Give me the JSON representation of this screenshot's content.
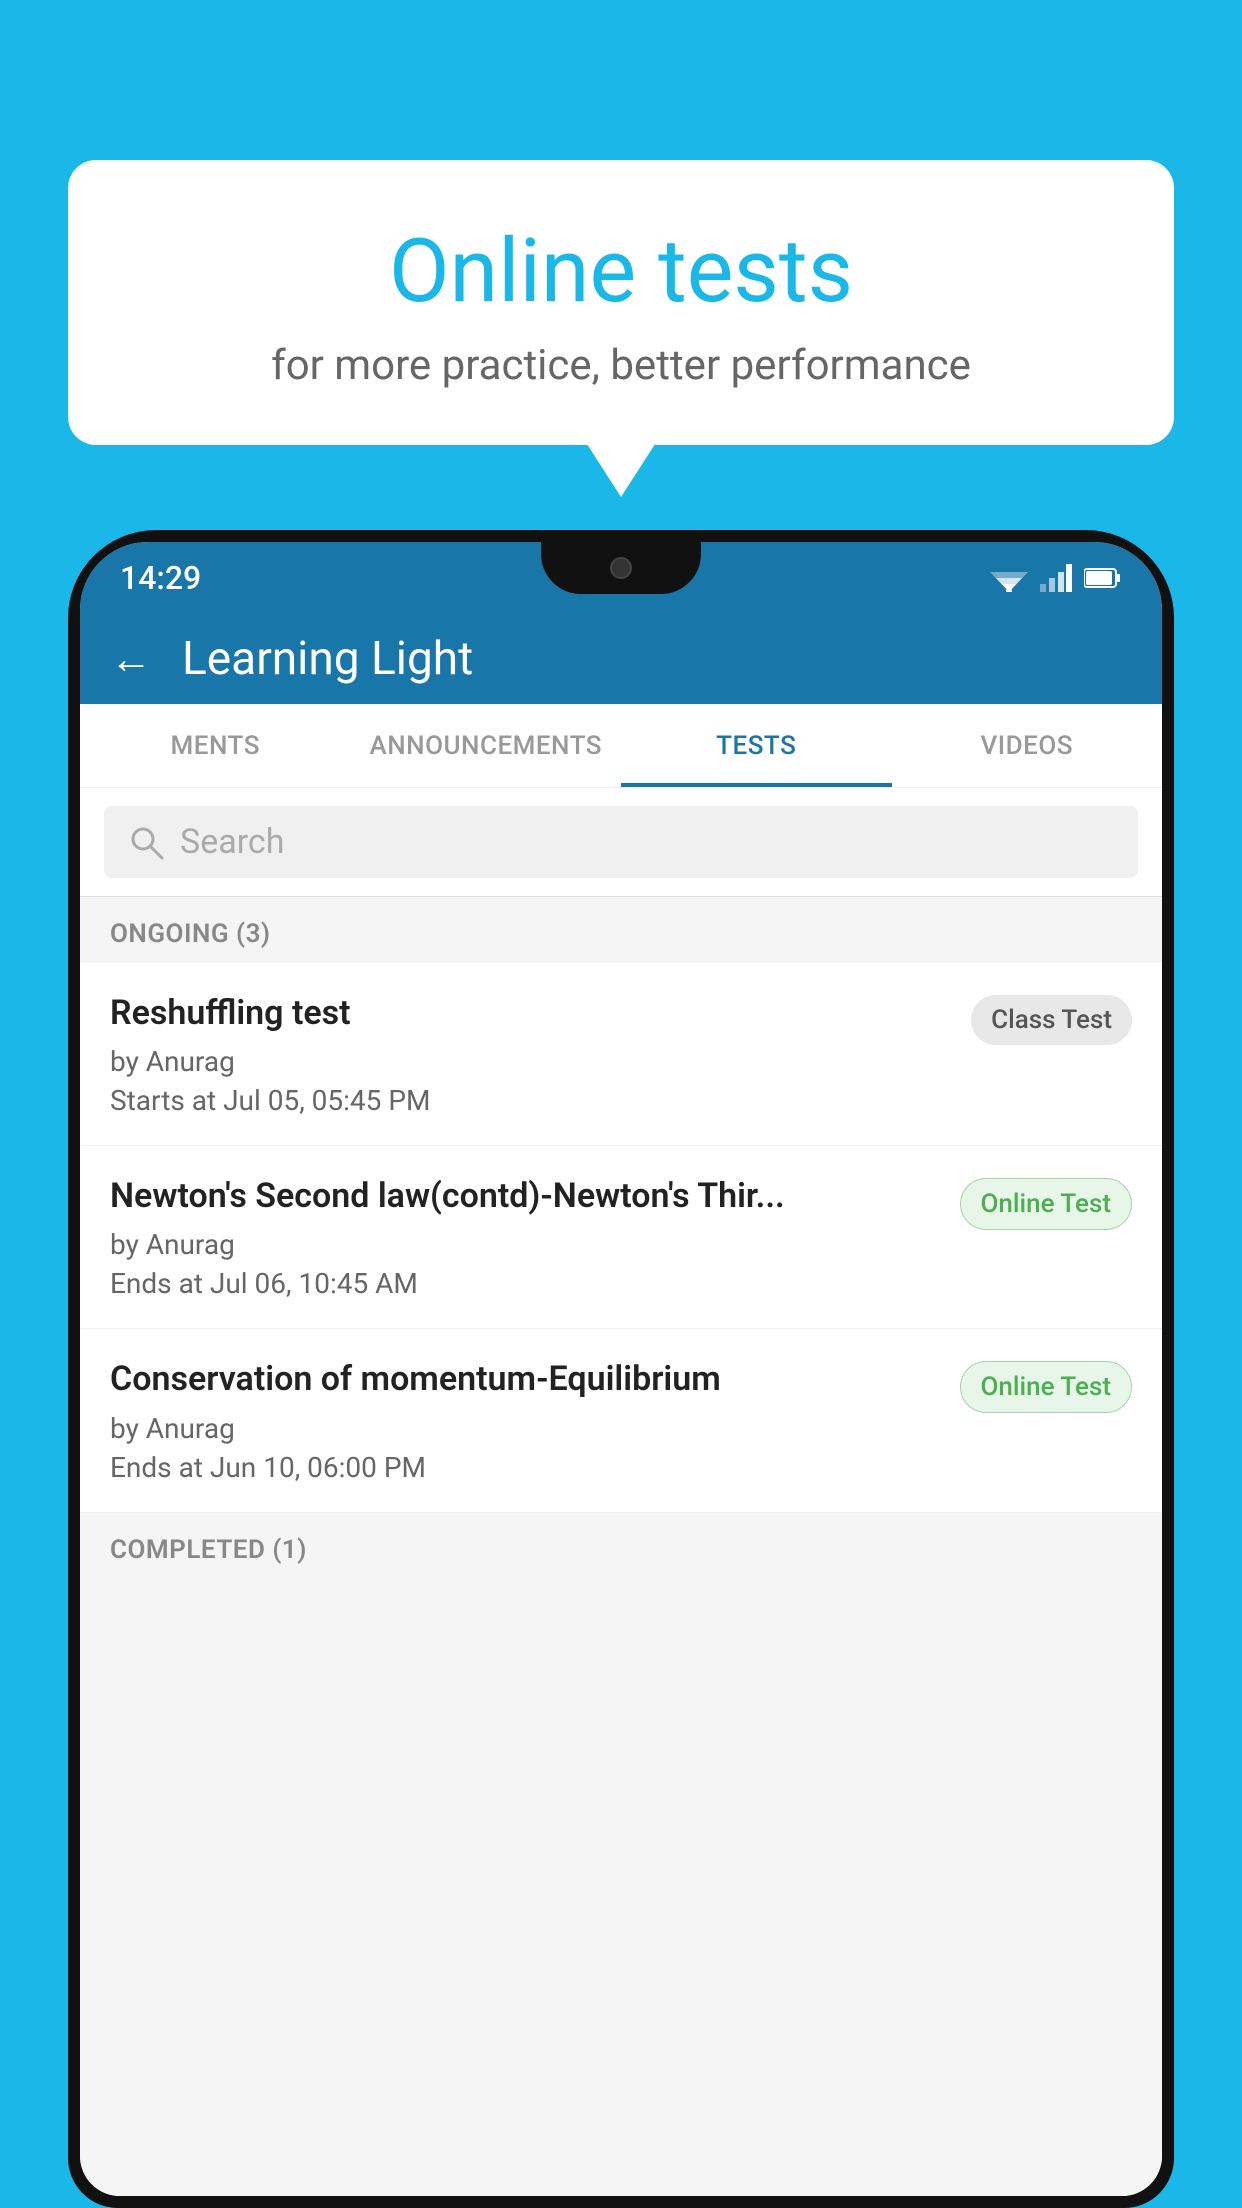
{
  "background_color": "#1ab8e8",
  "speech_bubble": {
    "title": "Online tests",
    "subtitle": "for more practice, better performance"
  },
  "phone": {
    "status_bar": {
      "time": "14:29",
      "icons": [
        "wifi",
        "signal",
        "battery"
      ]
    },
    "app_header": {
      "back_label": "←",
      "title": "Learning Light"
    },
    "tabs": [
      {
        "label": "MENTS",
        "active": false
      },
      {
        "label": "ANNOUNCEMENTS",
        "active": false
      },
      {
        "label": "TESTS",
        "active": true
      },
      {
        "label": "VIDEOS",
        "active": false
      }
    ],
    "search": {
      "placeholder": "Search"
    },
    "ongoing_section": {
      "label": "ONGOING (3)",
      "tests": [
        {
          "name": "Reshuffling test",
          "author": "by Anurag",
          "time_label": "Starts at",
          "time": "Jul 05, 05:45 PM",
          "badge": "Class Test",
          "badge_type": "class"
        },
        {
          "name": "Newton's Second law(contd)-Newton's Thir...",
          "author": "by Anurag",
          "time_label": "Ends at",
          "time": "Jul 06, 10:45 AM",
          "badge": "Online Test",
          "badge_type": "online"
        },
        {
          "name": "Conservation of momentum-Equilibrium",
          "author": "by Anurag",
          "time_label": "Ends at",
          "time": "Jun 10, 06:00 PM",
          "badge": "Online Test",
          "badge_type": "online"
        }
      ]
    },
    "completed_section": {
      "label": "COMPLETED (1)"
    }
  }
}
